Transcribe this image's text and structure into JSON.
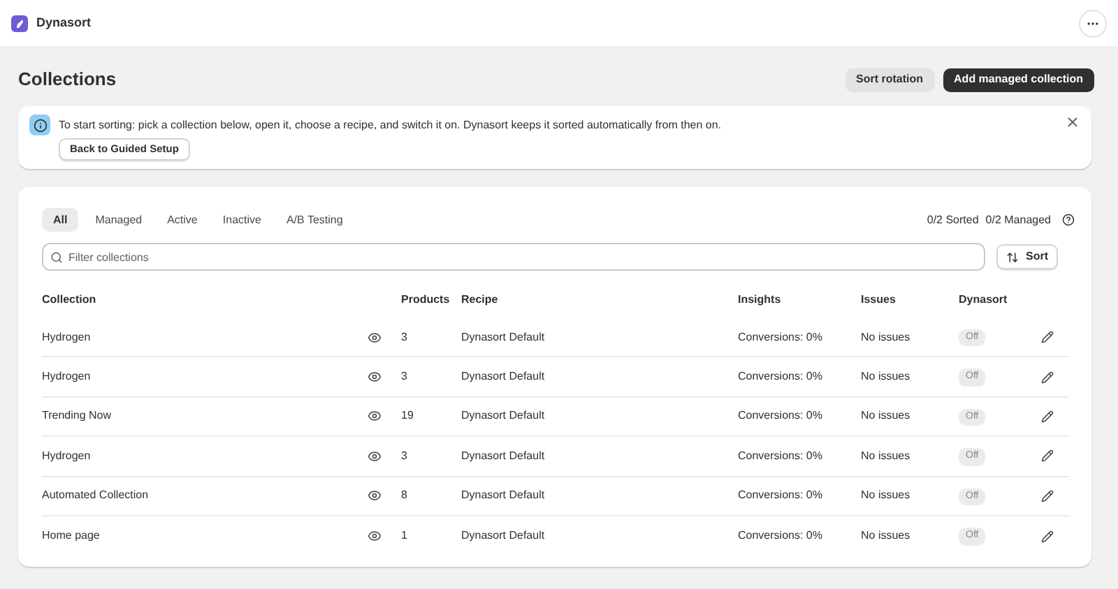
{
  "app": {
    "name": "Dynasort"
  },
  "page": {
    "title": "Collections",
    "actions": [
      {
        "label": "Sort rotation",
        "kind": "secondary"
      },
      {
        "label": "Add managed collection",
        "kind": "primary"
      }
    ]
  },
  "banner": {
    "text": "To start sorting: pick a collection below, open it, choose a recipe, and switch it on. Dynasort keeps it sorted automatically from then on.",
    "button": "Back to Guided Setup"
  },
  "tabs": [
    {
      "label": "All",
      "selected": true
    },
    {
      "label": "Managed",
      "selected": false
    },
    {
      "label": "Active",
      "selected": false
    },
    {
      "label": "Inactive",
      "selected": false
    },
    {
      "label": "A/B Testing",
      "selected": false
    }
  ],
  "summary": {
    "sorted": "0/2 Sorted",
    "managed": "0/2 Managed"
  },
  "search": {
    "placeholder": "Filter collections"
  },
  "sort_button": "Sort",
  "table": {
    "columns": [
      "Collection",
      "Products",
      "Recipe",
      "Insights",
      "Issues",
      "Dynasort"
    ],
    "rows": [
      {
        "collection": "Hydrogen",
        "products": "3",
        "recipe": "Dynasort Default",
        "insights": "Conversions: 0%",
        "issues": "No issues",
        "dynasort": {
          "label": "Off",
          "on": false
        }
      },
      {
        "collection": "Hydrogen",
        "products": "3",
        "recipe": "Dynasort Default",
        "insights": "Conversions: 0%",
        "issues": "No issues",
        "dynasort": {
          "label": "Off",
          "on": false
        }
      },
      {
        "collection": "Trending Now",
        "products": "19",
        "recipe": "Dynasort Default",
        "insights": "Conversions: 0%",
        "issues": "No issues",
        "dynasort": {
          "label": "Off",
          "on": false
        }
      },
      {
        "collection": "Hydrogen",
        "products": "3",
        "recipe": "Dynasort Default",
        "insights": "Conversions: 0%",
        "issues": "No issues",
        "dynasort": {
          "label": "Off",
          "on": false
        }
      },
      {
        "collection": "Automated Collection",
        "products": "8",
        "recipe": "Dynasort Default",
        "insights": "Conversions: 0%",
        "issues": "No issues",
        "dynasort": {
          "label": "Off",
          "on": false
        }
      },
      {
        "collection": "Home page",
        "products": "1",
        "recipe": "Dynasort Default",
        "insights": "Conversions: 0%",
        "issues": "No issues",
        "dynasort": {
          "label": "Off",
          "on": false
        }
      }
    ]
  }
}
